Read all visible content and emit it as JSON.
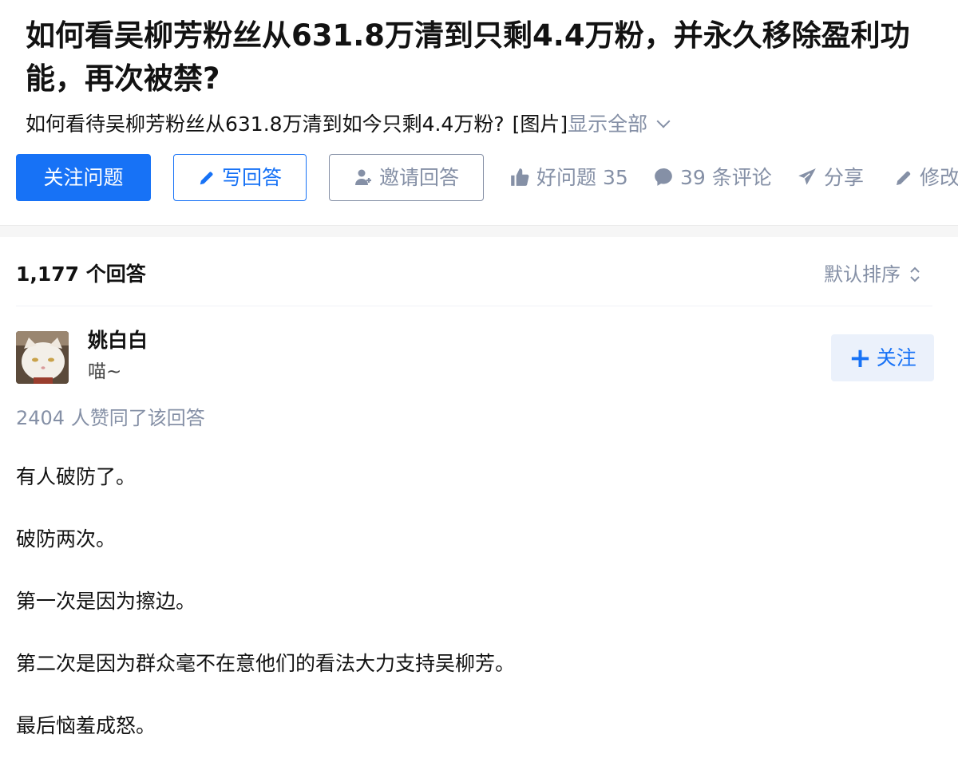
{
  "question": {
    "title": "如何看吴柳芳粉丝从631.8万清到只剩4.4万粉，并永久移除盈利功能，再次被禁?",
    "detail": "如何看待吴柳芳粉丝从631.8万清到如今只剩4.4万粉?",
    "image_tag": "[图片]",
    "show_all": "显示全部"
  },
  "actions": {
    "follow_question": "关注问题",
    "write_answer": "写回答",
    "invite_answer": "邀请回答",
    "good_question": "好问题 35",
    "comments": "39 条评论",
    "share": "分享",
    "edit": "修改"
  },
  "answers": {
    "count_label": "1,177 个回答",
    "sort_label": "默认排序"
  },
  "answer": {
    "author_name": "姚白白",
    "author_bio": "喵~",
    "follow_label": "关注",
    "vote_summary": "2404 人赞同了该回答",
    "paragraphs": [
      "有人破防了。",
      "破防两次。",
      "第一次是因为擦边。",
      "第二次是因为群众毫不在意他们的看法大力支持吴柳芳。",
      "最后恼羞成怒。"
    ]
  },
  "colors": {
    "brand": "#1772f6",
    "muted": "#8590a6",
    "text": "#121212"
  },
  "icons": [
    "pencil-icon",
    "invite-user-icon",
    "thumbs-up-icon",
    "comment-icon",
    "share-icon",
    "edit-icon",
    "chevron-down-icon",
    "sort-icon",
    "plus-icon"
  ]
}
